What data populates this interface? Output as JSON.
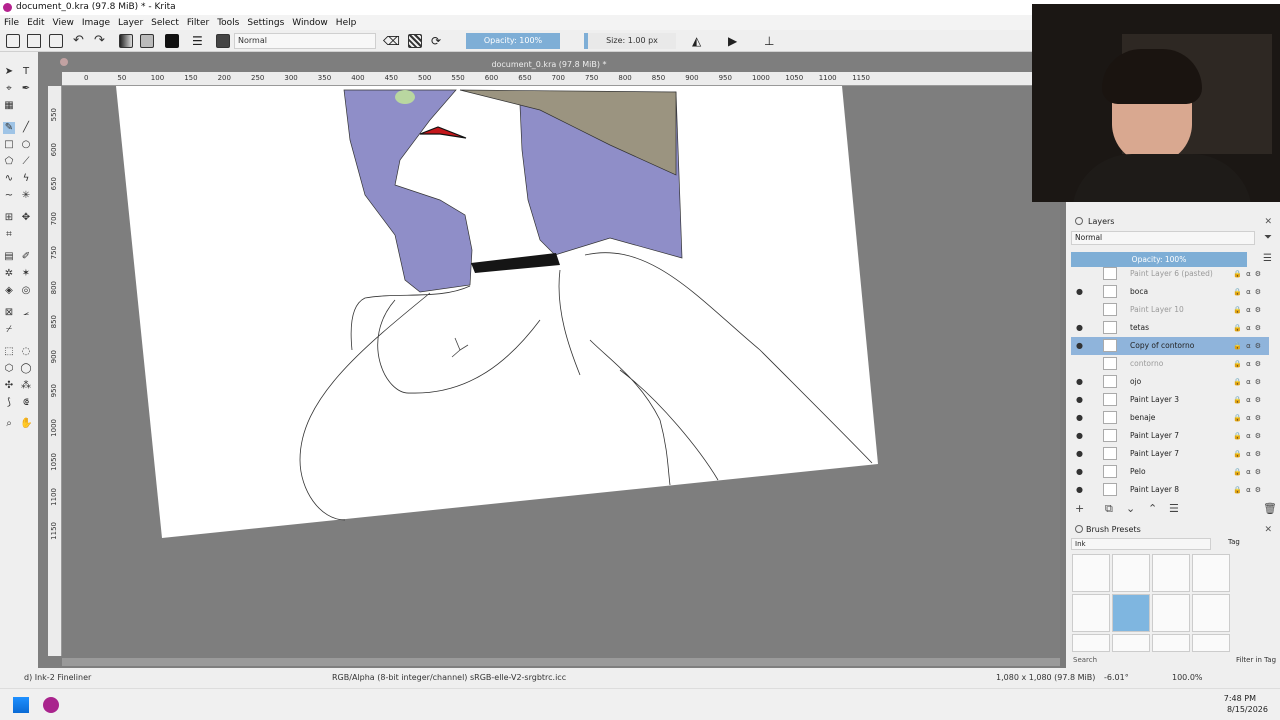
{
  "window": {
    "title": "document_0.kra (97.8 MiB) * - Krita"
  },
  "menu": [
    "File",
    "Edit",
    "View",
    "Image",
    "Layer",
    "Select",
    "Filter",
    "Tools",
    "Settings",
    "Window",
    "Help"
  ],
  "toolbar": {
    "blend_mode": "Normal",
    "opacity": "Opacity: 100%",
    "size": "Size: 1.00 px"
  },
  "canvas": {
    "doc_tab": "document_0.kra (97.8 MiB) *",
    "hruler_ticks": [
      "0",
      "50",
      "100",
      "150",
      "200",
      "250",
      "300",
      "350",
      "400",
      "450",
      "500",
      "550",
      "600",
      "650",
      "700",
      "750",
      "800",
      "850",
      "900",
      "950",
      "1000",
      "1050",
      "1100",
      "1150"
    ],
    "vruler_ticks": [
      "550",
      "600",
      "650",
      "700",
      "750",
      "800",
      "850",
      "900",
      "950",
      "1000",
      "1050",
      "1100",
      "1150"
    ]
  },
  "layers_panel": {
    "title": "Layers",
    "blend_mode": "Normal",
    "opacity": "Opacity: 100%",
    "layers": [
      {
        "name": "Paint Layer 6 (pasted)",
        "visible": false,
        "selected": false
      },
      {
        "name": "boca",
        "visible": true,
        "selected": false
      },
      {
        "name": "Paint Layer 10",
        "visible": false,
        "selected": false
      },
      {
        "name": "tetas",
        "visible": true,
        "selected": false
      },
      {
        "name": "Copy of contorno",
        "visible": true,
        "selected": true
      },
      {
        "name": "contorno",
        "visible": false,
        "selected": false
      },
      {
        "name": "ojo",
        "visible": true,
        "selected": false
      },
      {
        "name": "Paint Layer 3",
        "visible": true,
        "selected": false
      },
      {
        "name": "benaje",
        "visible": true,
        "selected": false
      },
      {
        "name": "Paint Layer 7",
        "visible": true,
        "selected": false
      },
      {
        "name": "Paint Layer 7",
        "visible": true,
        "selected": false
      },
      {
        "name": "Pelo",
        "visible": true,
        "selected": false
      },
      {
        "name": "Paint Layer 8",
        "visible": true,
        "selected": false
      }
    ]
  },
  "brush_presets": {
    "title": "Brush Presets",
    "tag": "Ink",
    "tag_label": "Tag",
    "search_placeholder": "Search",
    "filter_in_tag": "Filter in Tag"
  },
  "status": {
    "brush": "d) Ink-2 Fineliner",
    "color_profile": "RGB/Alpha (8-bit integer/channel)  sRGB-elle-V2-srgbtrc.icc",
    "image_size": "1,080 x 1,080 (97.8 MiB)",
    "rotation": "-6.01°",
    "zoom": "100.0%"
  },
  "taskbar": {
    "time": "7:48 PM",
    "date": "8/15/2026"
  }
}
